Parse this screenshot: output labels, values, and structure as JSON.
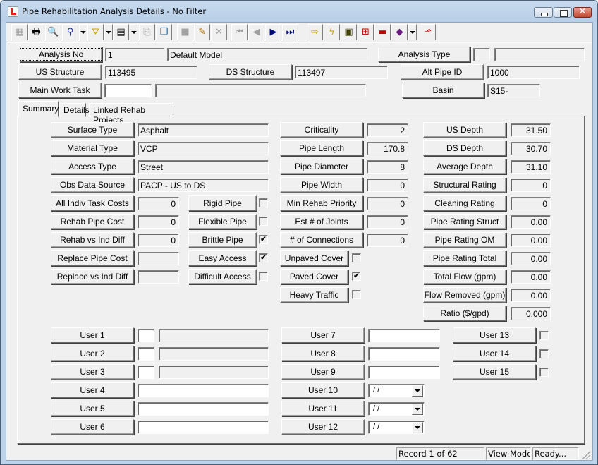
{
  "window": {
    "title": "Pipe Rehabilitation Analysis Details - No Filter",
    "controls": {
      "close_glyph": "✕"
    }
  },
  "toolbar": {
    "buttons": [
      {
        "name": "form-view-icon",
        "glyph": "▦",
        "enabled": false
      },
      {
        "name": "print-icon",
        "glyph": "🖶",
        "enabled": true
      },
      {
        "name": "print-preview-icon",
        "glyph": "🔍",
        "enabled": true
      },
      {
        "name": "find-icon",
        "glyph": "⚲",
        "enabled": true,
        "dropdown": true
      },
      {
        "name": "filter-icon",
        "glyph": "⛛",
        "enabled": true,
        "dropdown": true
      },
      {
        "name": "report-icon",
        "glyph": "▤",
        "enabled": true,
        "dropdown": true
      },
      {
        "name": "export-icon",
        "glyph": "⎘",
        "enabled": false
      },
      {
        "name": "copy-icon",
        "glyph": "❐",
        "enabled": true
      },
      {
        "name": "save-icon",
        "glyph": "■",
        "enabled": false
      },
      {
        "name": "edit-pencil-icon",
        "glyph": "✎",
        "enabled": true
      },
      {
        "name": "delete-icon",
        "glyph": "✕",
        "enabled": false
      },
      {
        "name": "first-record-icon",
        "glyph": "⏮",
        "enabled": false
      },
      {
        "name": "previous-record-icon",
        "glyph": "◀",
        "enabled": false
      },
      {
        "name": "next-record-icon",
        "glyph": "▶",
        "enabled": true
      },
      {
        "name": "last-record-icon",
        "glyph": "⏭",
        "enabled": true
      },
      {
        "name": "goto-arrow-icon",
        "glyph": "⇨",
        "enabled": true
      },
      {
        "name": "lightning-icon",
        "glyph": "ϟ",
        "enabled": true
      },
      {
        "name": "map-icon",
        "glyph": "▣",
        "enabled": true
      },
      {
        "name": "network-icon",
        "glyph": "⊞",
        "enabled": true
      },
      {
        "name": "toolbox-icon",
        "glyph": "▬",
        "enabled": true
      },
      {
        "name": "help-book-icon",
        "glyph": "◆",
        "enabled": true,
        "dropdown": true
      },
      {
        "name": "exit-icon",
        "glyph": "⬏",
        "enabled": true
      }
    ]
  },
  "header": {
    "analysis_no": {
      "label": "Analysis No",
      "value": "1",
      "description": "Default Model"
    },
    "analysis_type": {
      "label": "Analysis Type",
      "code": "",
      "description": ""
    },
    "us_structure": {
      "label": "US Structure",
      "value": "113495"
    },
    "ds_structure": {
      "label": "DS Structure",
      "value": "113497"
    },
    "alt_pipe_id": {
      "label": "Alt Pipe ID",
      "value": "1000"
    },
    "main_work_task": {
      "label": "Main Work Task",
      "code": "",
      "description": ""
    },
    "basin": {
      "label": "Basin",
      "value": "S15-"
    }
  },
  "tabs": [
    {
      "label": "Summary",
      "active": true
    },
    {
      "label": "Details",
      "active": false
    },
    {
      "label": "Linked Rehab Projects",
      "active": false
    }
  ],
  "summary": {
    "text_fields": [
      {
        "label": "Surface Type",
        "value": "Asphalt"
      },
      {
        "label": "Material Type",
        "value": "VCP"
      },
      {
        "label": "Access Type",
        "value": "Street"
      },
      {
        "label": "Obs Data Source",
        "value": "PACP - US to DS"
      }
    ],
    "cost_fields": [
      {
        "label": "All Indiv Task Costs",
        "value": "0"
      },
      {
        "label": "Rehab Pipe Cost",
        "value": "0"
      },
      {
        "label": "Rehab vs Ind Diff",
        "value": "0"
      },
      {
        "label": "Replace Pipe Cost",
        "value": ""
      },
      {
        "label": "Replace vs Ind Diff",
        "value": ""
      }
    ],
    "pipe_flags": [
      {
        "label": "Rigid Pipe",
        "checked": false
      },
      {
        "label": "Flexible Pipe",
        "checked": false
      },
      {
        "label": "Brittle Pipe",
        "checked": true
      },
      {
        "label": "Easy Access",
        "checked": true
      },
      {
        "label": "Difficult Access",
        "checked": false
      }
    ],
    "pipe_metrics": [
      {
        "label": "Criticality",
        "value": "2"
      },
      {
        "label": "Pipe Length",
        "value": "170.8"
      },
      {
        "label": "Pipe Diameter",
        "value": "8"
      },
      {
        "label": "Pipe Width",
        "value": "0"
      },
      {
        "label": "Min Rehab Priority",
        "value": "0"
      },
      {
        "label": "Est # of Joints",
        "value": "0"
      },
      {
        "label": "# of Connections",
        "value": "0"
      }
    ],
    "cover_flags": [
      {
        "label": "Unpaved Cover",
        "checked": false
      },
      {
        "label": "Paved Cover",
        "checked": true
      },
      {
        "label": "Heavy Traffic",
        "checked": false
      }
    ],
    "ratings": [
      {
        "label": "US Depth",
        "value": "31.50"
      },
      {
        "label": "DS Depth",
        "value": "30.70"
      },
      {
        "label": "Average Depth",
        "value": "31.10"
      },
      {
        "label": "Structural Rating",
        "value": "0"
      },
      {
        "label": "Cleaning Rating",
        "value": "0"
      },
      {
        "label": "Pipe Rating Struct",
        "value": "0.00"
      },
      {
        "label": "Pipe Rating OM",
        "value": "0.00"
      },
      {
        "label": "Pipe Rating Total",
        "value": "0.00"
      },
      {
        "label": "Total Flow (gpm)",
        "value": "0.00"
      },
      {
        "label": "Flow Removed (gpm)",
        "value": "0.00"
      },
      {
        "label": "Ratio ($/gpd)",
        "value": "0.000"
      }
    ],
    "user_code_fields": [
      {
        "label": "User 1",
        "code": "",
        "description": ""
      },
      {
        "label": "User 2",
        "code": "",
        "description": ""
      },
      {
        "label": "User 3",
        "code": "",
        "description": ""
      }
    ],
    "user_text_fields_left": [
      {
        "label": "User 4",
        "value": ""
      },
      {
        "label": "User 5",
        "value": ""
      },
      {
        "label": "User 6",
        "value": ""
      }
    ],
    "user_text_fields_mid": [
      {
        "label": "User 7",
        "value": ""
      },
      {
        "label": "User 8",
        "value": ""
      },
      {
        "label": "User 9",
        "value": ""
      }
    ],
    "user_date_fields": [
      {
        "label": "User 10",
        "value": " /  /"
      },
      {
        "label": "User 11",
        "value": " /  /"
      },
      {
        "label": "User 12",
        "value": " /  /"
      }
    ],
    "user_flags": [
      {
        "label": "User 13",
        "checked": false
      },
      {
        "label": "User 14",
        "checked": false
      },
      {
        "label": "User 15",
        "checked": false
      }
    ]
  },
  "status_bar": {
    "record": "Record 1 of 62",
    "mode": "View Mode",
    "state": "Ready..."
  }
}
